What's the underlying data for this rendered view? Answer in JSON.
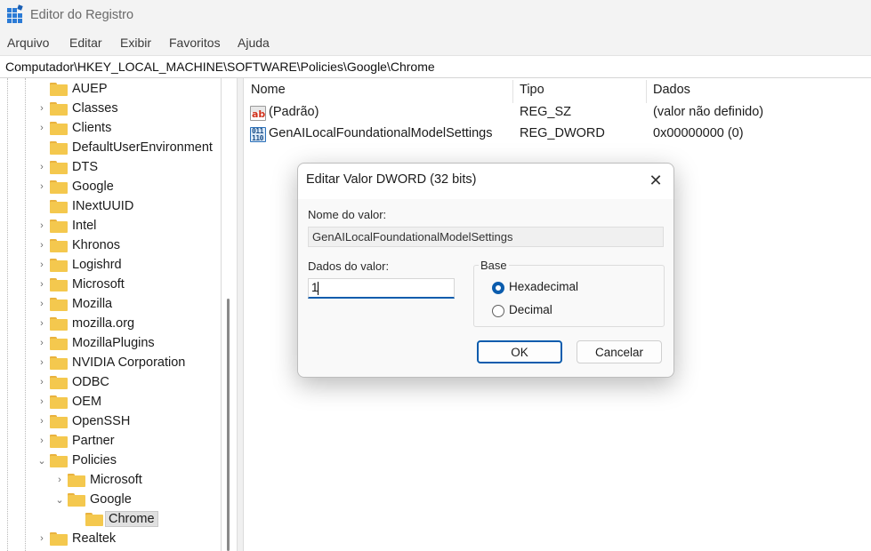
{
  "window": {
    "title": "Editor do Registro"
  },
  "menu": [
    "Arquivo",
    "Editar",
    "Exibir",
    "Favoritos",
    "Ajuda"
  ],
  "address": "Computador\\HKEY_LOCAL_MACHINE\\SOFTWARE\\Policies\\Google\\Chrome",
  "tree": [
    {
      "label": "AUEP",
      "chevron": ""
    },
    {
      "label": "Classes",
      "chevron": "›"
    },
    {
      "label": "Clients",
      "chevron": "›"
    },
    {
      "label": "DefaultUserEnvironment",
      "chevron": ""
    },
    {
      "label": "DTS",
      "chevron": "›"
    },
    {
      "label": "Google",
      "chevron": "›"
    },
    {
      "label": "INextUUID",
      "chevron": ""
    },
    {
      "label": "Intel",
      "chevron": "›"
    },
    {
      "label": "Khronos",
      "chevron": "›"
    },
    {
      "label": "Logishrd",
      "chevron": "›"
    },
    {
      "label": "Microsoft",
      "chevron": "›"
    },
    {
      "label": "Mozilla",
      "chevron": "›"
    },
    {
      "label": "mozilla.org",
      "chevron": "›"
    },
    {
      "label": "MozillaPlugins",
      "chevron": "›"
    },
    {
      "label": "NVIDIA Corporation",
      "chevron": "›"
    },
    {
      "label": "ODBC",
      "chevron": "›"
    },
    {
      "label": "OEM",
      "chevron": "›"
    },
    {
      "label": "OpenSSH",
      "chevron": "›"
    },
    {
      "label": "Partner",
      "chevron": "›"
    },
    {
      "label": "Policies",
      "chevron": "⌄"
    },
    {
      "label": "Microsoft",
      "chevron": "›"
    },
    {
      "label": "Google",
      "chevron": "⌄"
    },
    {
      "label": "Chrome",
      "chevron": ""
    },
    {
      "label": "Realtek",
      "chevron": "›"
    }
  ],
  "list": {
    "columns": [
      "Nome",
      "Tipo",
      "Dados"
    ],
    "rows": [
      {
        "icon": "string-value-icon",
        "name": "(Padrão)",
        "type": "REG_SZ",
        "data": "(valor não definido)"
      },
      {
        "icon": "binary-value-icon",
        "name": "GenAILocalFoundationalModelSettings",
        "type": "REG_DWORD",
        "data": "0x00000000 (0)"
      }
    ]
  },
  "dialog": {
    "title": "Editar Valor DWORD (32 bits)",
    "close_glyph": "✕",
    "name_label": "Nome do valor:",
    "name_value": "GenAILocalFoundationalModelSettings",
    "data_label": "Dados do valor:",
    "data_value": "1",
    "base_label": "Base",
    "radio_hex": "Hexadecimal",
    "radio_dec": "Decimal",
    "selected_base": "Hexadecimal",
    "ok": "OK",
    "cancel": "Cancelar"
  },
  "colors": {
    "accent": "#0b5cad",
    "folder": "#f4c84e"
  }
}
